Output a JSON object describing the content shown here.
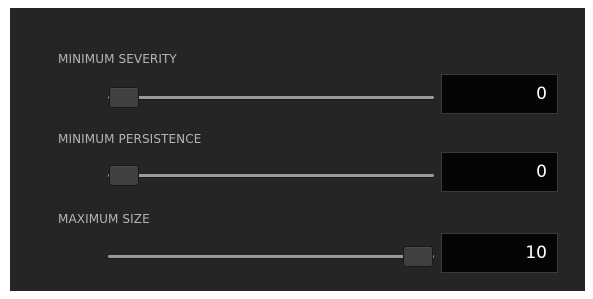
{
  "controls": [
    {
      "label": "MINIMUM SEVERITY",
      "value": "0",
      "slider_fraction": 0.0
    },
    {
      "label": "MINIMUM PERSISTENCE",
      "value": "0",
      "slider_fraction": 0.0
    },
    {
      "label": "MAXIMUM SIZE",
      "value": "10",
      "slider_fraction": 1.0
    }
  ]
}
